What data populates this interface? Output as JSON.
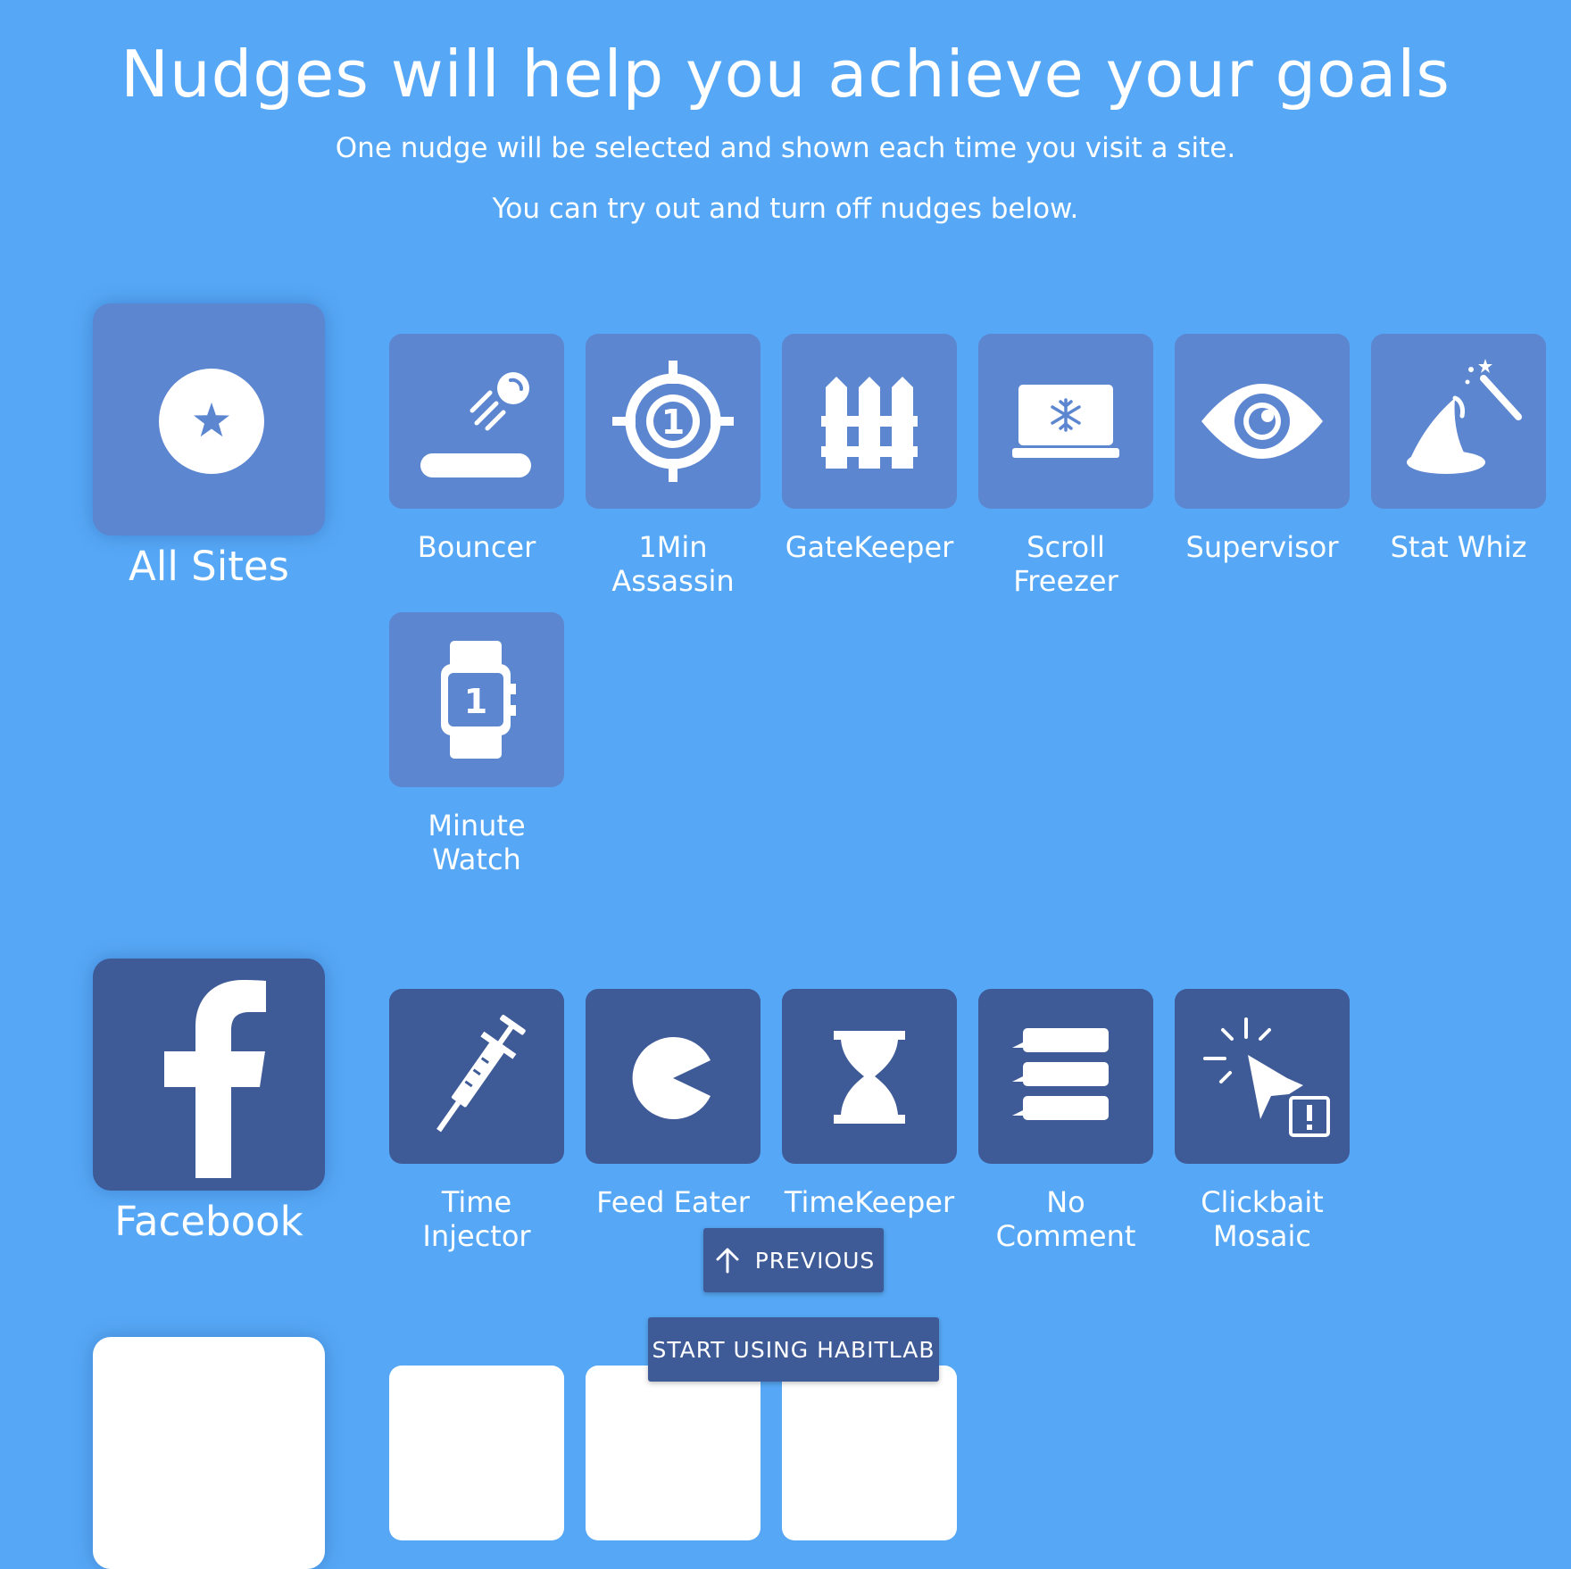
{
  "header": {
    "title": "Nudges will help you achieve your goals",
    "subtitle1": "One nudge will be selected and shown each time you visit a site.",
    "subtitle2": "You can try out and turn off nudges below."
  },
  "colors": {
    "background": "#56a8f6",
    "all_sites_tile": "#5d86d1",
    "facebook_tile": "#3e5b97",
    "button": "#3e5b97"
  },
  "sites": [
    {
      "label": "All Sites",
      "icon": "star-circle-icon",
      "nudges": [
        {
          "label": "Bouncer",
          "icon": "bouncer-icon"
        },
        {
          "label": "1Min\nAssassin",
          "icon": "crosshair-icon"
        },
        {
          "label": "GateKeeper",
          "icon": "fence-icon"
        },
        {
          "label": "Scroll\nFreezer",
          "icon": "frozen-laptop-icon"
        },
        {
          "label": "Supervisor",
          "icon": "eye-icon"
        },
        {
          "label": "Stat Whiz",
          "icon": "wizard-hat-icon"
        },
        {
          "label": "Minute\nWatch",
          "icon": "smartwatch-icon"
        }
      ]
    },
    {
      "label": "Facebook",
      "icon": "facebook-icon",
      "nudges": [
        {
          "label": "Time\nInjector",
          "icon": "syringe-icon"
        },
        {
          "label": "Feed Eater",
          "icon": "pacman-icon"
        },
        {
          "label": "TimeKeeper",
          "icon": "hourglass-icon"
        },
        {
          "label": "No\nComment",
          "icon": "comments-icon"
        },
        {
          "label": "Clickbait\nMosaic",
          "icon": "clickbait-cursor-icon"
        }
      ]
    }
  ],
  "buttons": {
    "previous": "PREVIOUS",
    "start": "START USING HABITLAB"
  }
}
